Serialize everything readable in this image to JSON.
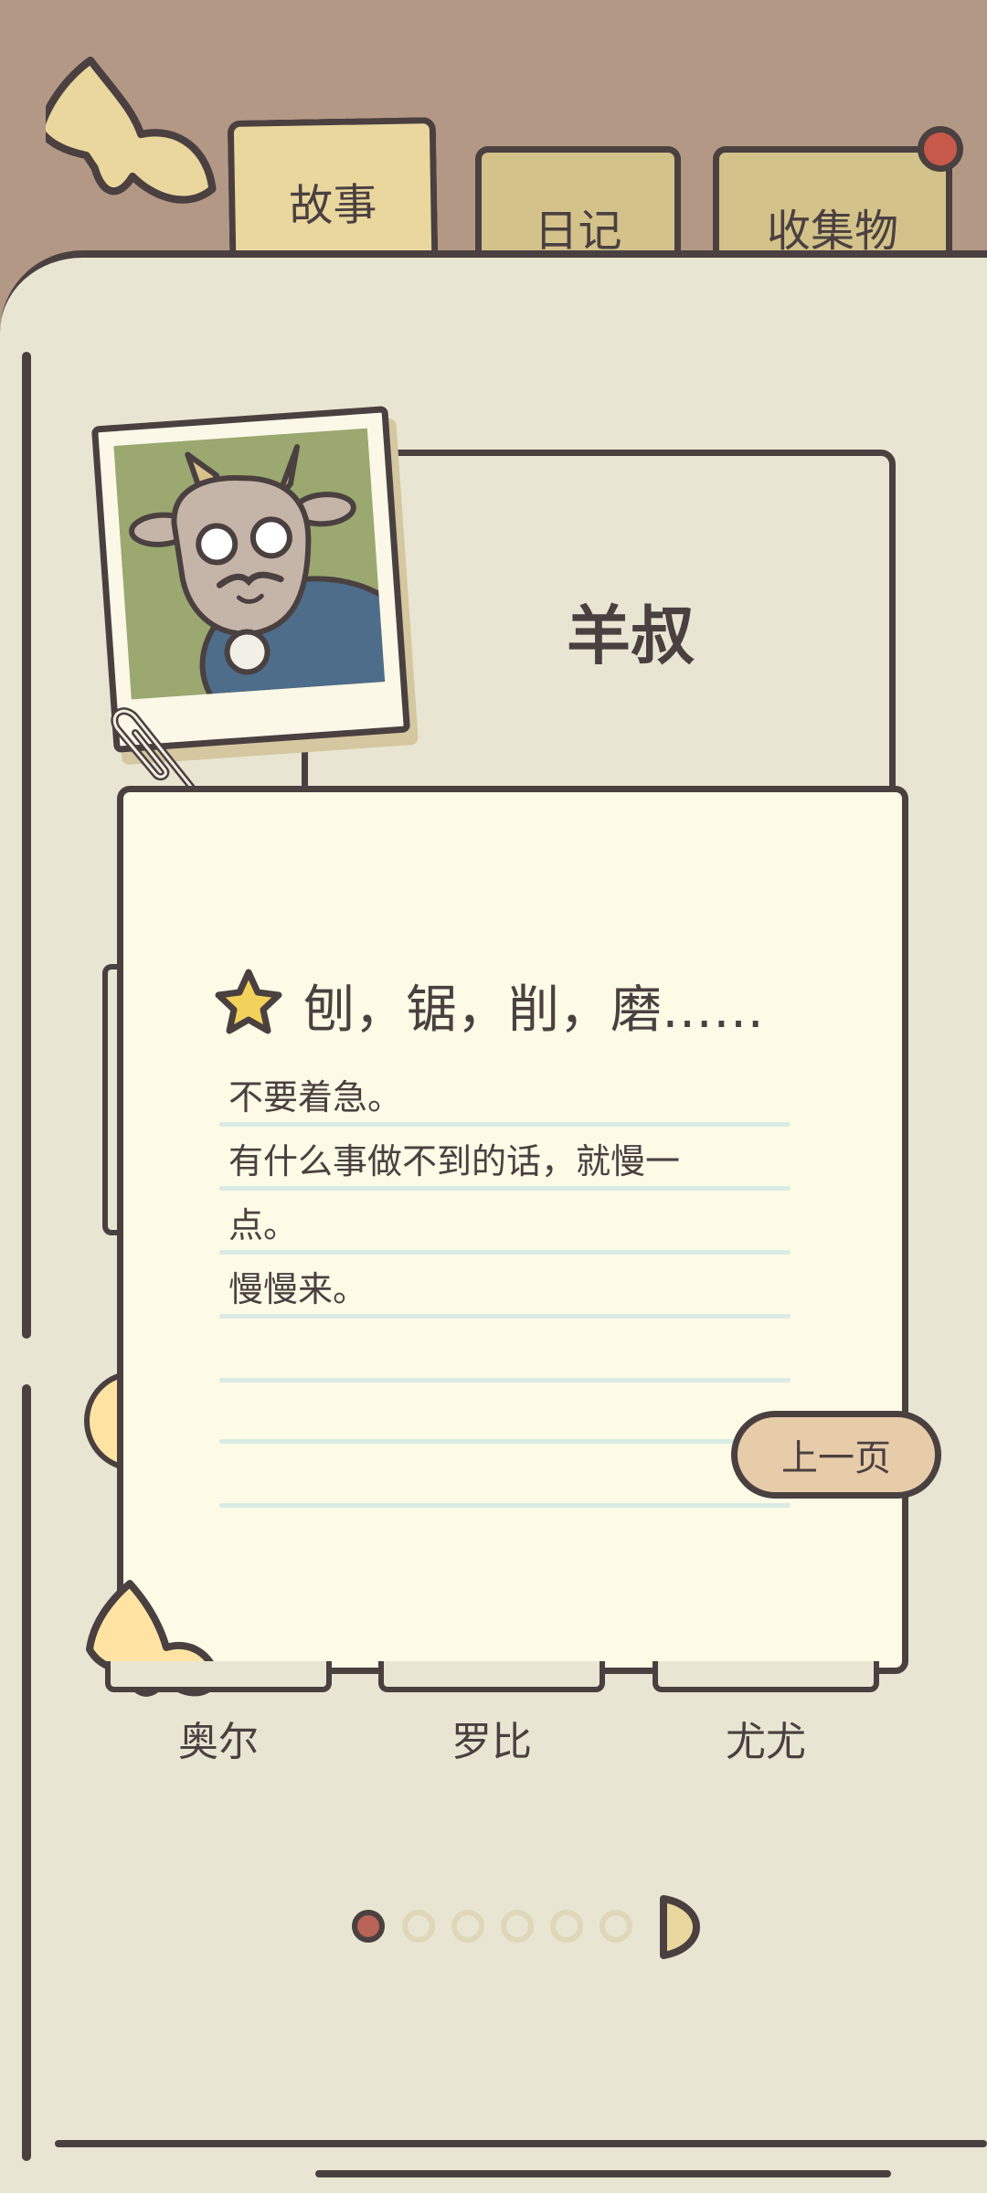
{
  "tabs": [
    {
      "label": "故事",
      "active": true
    },
    {
      "label": "日记",
      "active": false
    },
    {
      "label": "收集物",
      "active": false,
      "has_notification": true
    }
  ],
  "character": {
    "name": "羊叔"
  },
  "note": {
    "title": "刨，锯，削，磨……",
    "lines": [
      "不要着急。",
      "有什么事做不到的话，就慢一",
      "点。",
      "慢慢来。"
    ]
  },
  "buttons": {
    "prev_page": "上一页"
  },
  "characters": [
    {
      "name": "奥尔"
    },
    {
      "name": "罗比"
    },
    {
      "name": "尤尤"
    }
  ],
  "pagination": {
    "current": 1,
    "total": 6
  },
  "colors": {
    "background": "#b39885",
    "paper": "#fdfae6",
    "book": "#e8e6d2",
    "outline": "#4a4040",
    "tab_active": "#ead79e",
    "tab_inactive": "#d3c28a",
    "notification": "#c7594a",
    "button": "#e7ccaa"
  },
  "icons": {
    "back": "back-arrow-icon",
    "star": "star-icon",
    "next_page": "next-page-arrow-icon"
  }
}
